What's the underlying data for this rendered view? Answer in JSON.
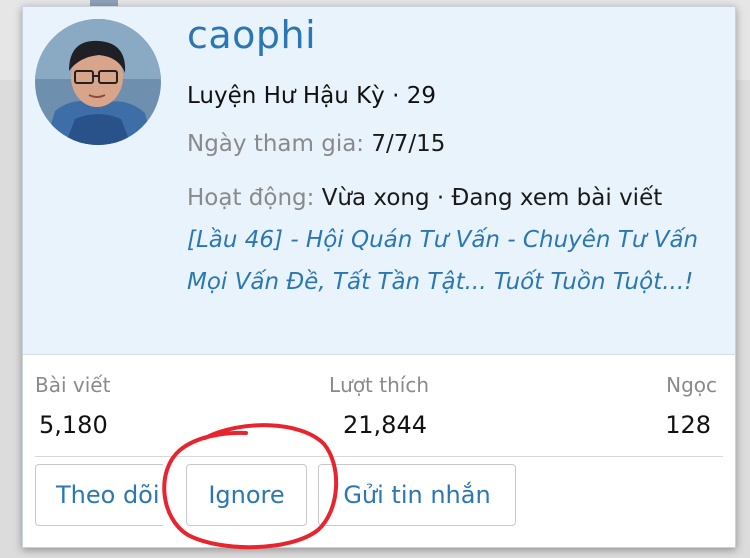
{
  "profile": {
    "username": "caophi",
    "rank": "Luyện Hư Hậu Kỳ · 29",
    "joined_label": "Ngày tham gia:",
    "joined_value": "7/7/15",
    "activity_label": "Hoạt động:",
    "activity_value": "Vừa xong · Đang xem bài viết",
    "thread_link": "[Lầu 46] - Hội Quán Tư Vấn - Chuyên Tư Vấn Mọi Vấn Đề, Tất Tần Tật... Tuốt Tuồn Tuột...!"
  },
  "stats": {
    "posts_label": "Bài viết",
    "posts_value": "5,180",
    "likes_label": "Lượt thích",
    "likes_value": "21,844",
    "gems_label": "Ngọc",
    "gems_value": "128"
  },
  "actions": {
    "follow_label": "Theo dõi",
    "ignore_label": "Ignore",
    "message_label": "Gửi tin nhắn"
  },
  "colors": {
    "link": "#2b77b4",
    "info_bg": "#e9f3fc",
    "annotation": "#e8252e"
  },
  "icons": {
    "avatar": "user-avatar-illustration"
  }
}
